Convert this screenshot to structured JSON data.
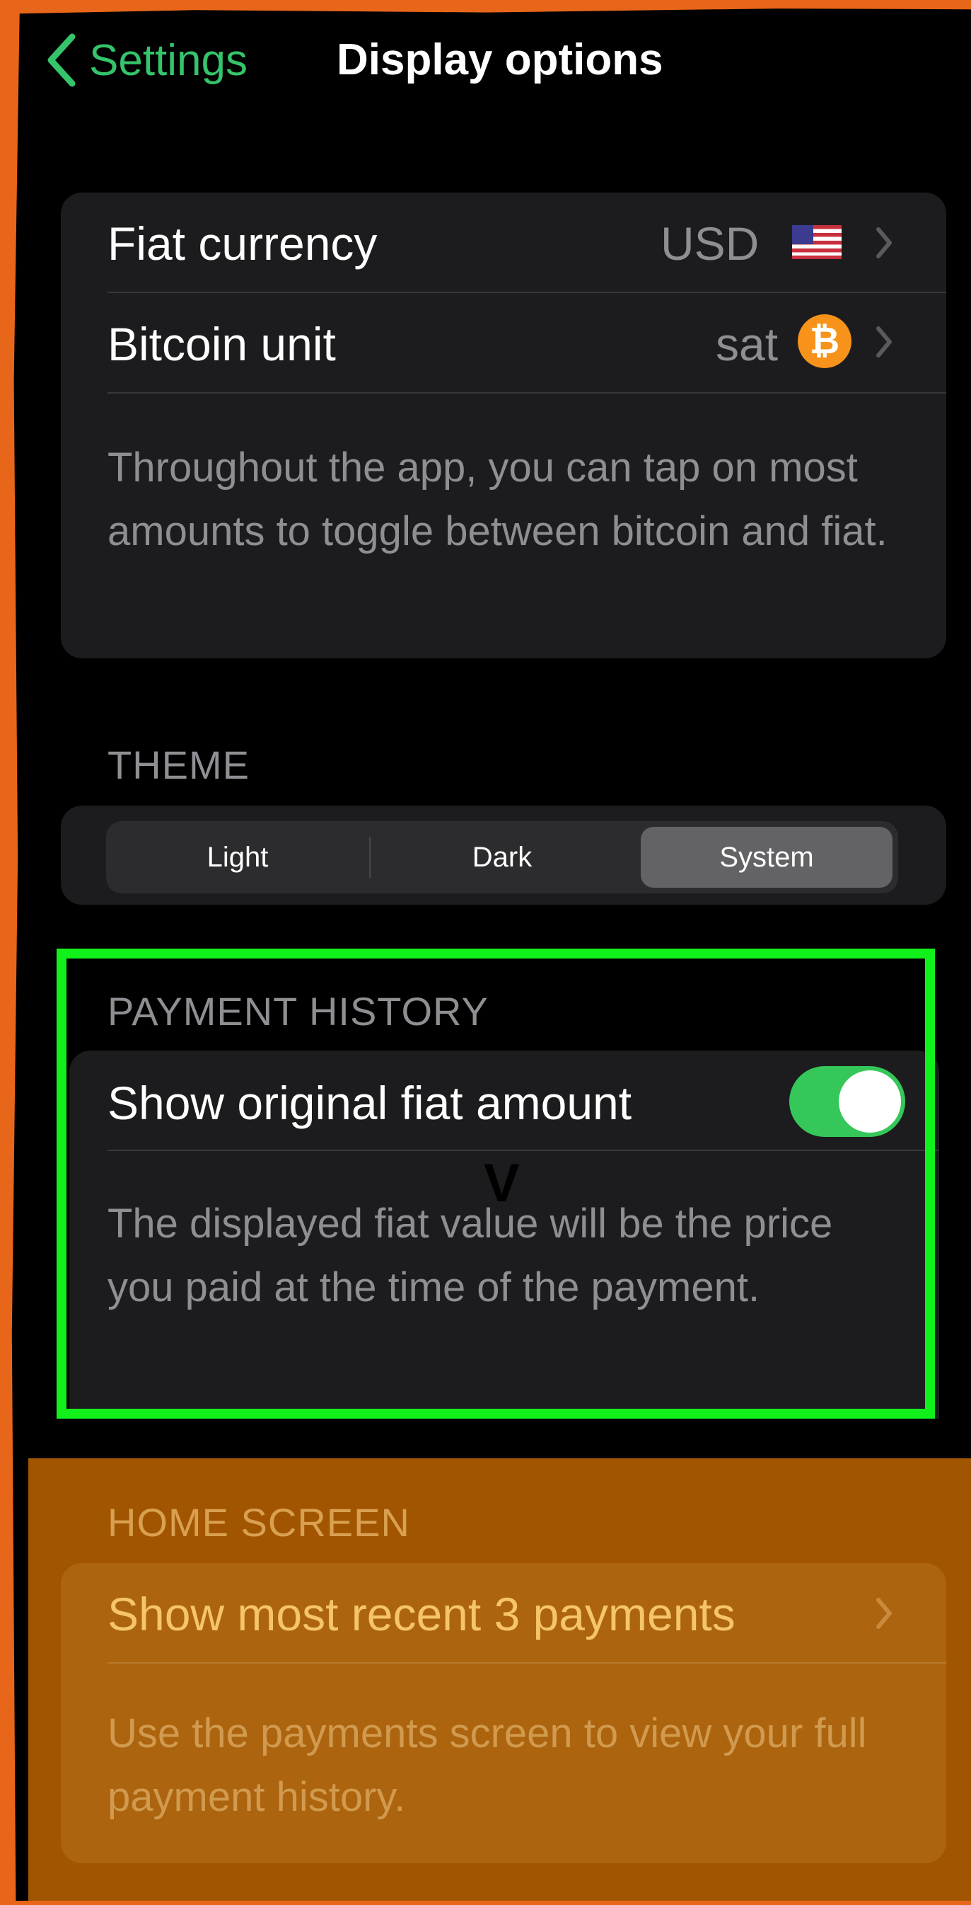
{
  "nav": {
    "back_label": "Settings",
    "title": "Display options"
  },
  "currency_card": {
    "rows": [
      {
        "label": "Fiat currency",
        "value": "USD",
        "badge": "🇺🇸"
      },
      {
        "label": "Bitcoin unit",
        "value": "sat",
        "badge": "₿"
      }
    ],
    "footnote": "Throughout the app, you can tap on most amounts to toggle between bitcoin and fiat."
  },
  "theme": {
    "header": "THEME",
    "options": [
      "Light",
      "Dark",
      "System"
    ],
    "selected": "System"
  },
  "payment_history": {
    "header": "PAYMENT HISTORY",
    "toggle_label": "Show original fiat amount",
    "toggle_on": true,
    "annotation": "V",
    "footnote": "The displayed fiat value will be the price you paid at the time of the payment."
  },
  "home_screen": {
    "header": "HOME SCREEN",
    "row_label": "Show most recent 3 payments",
    "footnote": "Use the payments screen to view your full payment history."
  },
  "colors": {
    "accent_green": "#35c46b",
    "toggle_green": "#35c759",
    "bitcoin_orange": "#f7931a",
    "highlight_green": "#12f01c",
    "overlay_orange": "#a15500"
  },
  "icons": {
    "back": "chevron-left-icon",
    "disclosure": "chevron-right-icon",
    "flag": "us-flag-icon",
    "bitcoin": "bitcoin-icon"
  }
}
